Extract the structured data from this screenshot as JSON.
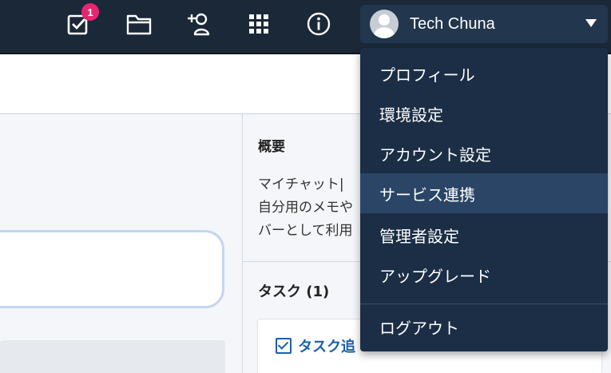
{
  "topbar": {
    "tasks_badge_count": "1",
    "icons": [
      "task-check-icon",
      "folder-icon",
      "add-contact-icon",
      "apps-grid-icon",
      "info-icon"
    ]
  },
  "user": {
    "name": "Tech Chuna"
  },
  "dropdown": {
    "items": [
      {
        "label": "プロフィール"
      },
      {
        "label": "環境設定"
      },
      {
        "label": "アカウント設定"
      },
      {
        "label": "サービス連携"
      },
      {
        "label": "管理者設定"
      },
      {
        "label": "アップグレード"
      },
      {
        "label": "ログアウト"
      }
    ],
    "active_index": 3
  },
  "side_panel": {
    "title": "概要",
    "description_lines": [
      "マイチャット|",
      "自分用のメモや",
      "バーとして利用"
    ],
    "task_heading": "タスク (1)",
    "task_card_label": "タスク追"
  },
  "colors": {
    "topbar_bg": "#1b2838",
    "dropdown_bg": "#1b2e45",
    "active_item_bg": "#2a4566",
    "badge": "#e8256f",
    "link_blue": "#1d5fa8"
  }
}
